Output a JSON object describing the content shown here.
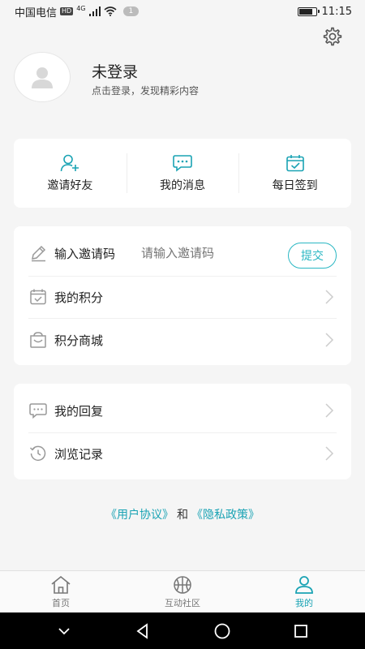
{
  "status_bar": {
    "carrier": "中国电信",
    "hd": "HD",
    "network": "4G",
    "notification_count": "1",
    "battery_level": 0.85,
    "time": "11:15"
  },
  "profile": {
    "title": "未登录",
    "subtitle": "点击登录，发现精彩内容"
  },
  "quick_actions": [
    {
      "label": "邀请好友",
      "icon": "invite-friend-icon"
    },
    {
      "label": "我的消息",
      "icon": "message-icon"
    },
    {
      "label": "每日签到",
      "icon": "calendar-check-icon"
    }
  ],
  "invite": {
    "label": "输入邀请码",
    "placeholder": "请输入邀请码",
    "submit_label": "提交"
  },
  "menu_group_1": [
    {
      "label": "我的积分",
      "icon": "points-icon"
    },
    {
      "label": "积分商城",
      "icon": "shop-icon"
    }
  ],
  "menu_group_2": [
    {
      "label": "我的回复",
      "icon": "reply-icon"
    },
    {
      "label": "浏览记录",
      "icon": "history-icon"
    }
  ],
  "legal": {
    "user_agreement": "《用户协议》",
    "and": "和",
    "privacy_policy": "《隐私政策》"
  },
  "tabs": [
    {
      "label": "首页",
      "icon": "home-icon",
      "active": false
    },
    {
      "label": "互动社区",
      "icon": "community-icon",
      "active": false
    },
    {
      "label": "我的",
      "icon": "profile-icon",
      "active": true
    }
  ],
  "colors": {
    "accent": "#1aa3b4",
    "background": "#f5f5f5",
    "card": "#ffffff"
  }
}
